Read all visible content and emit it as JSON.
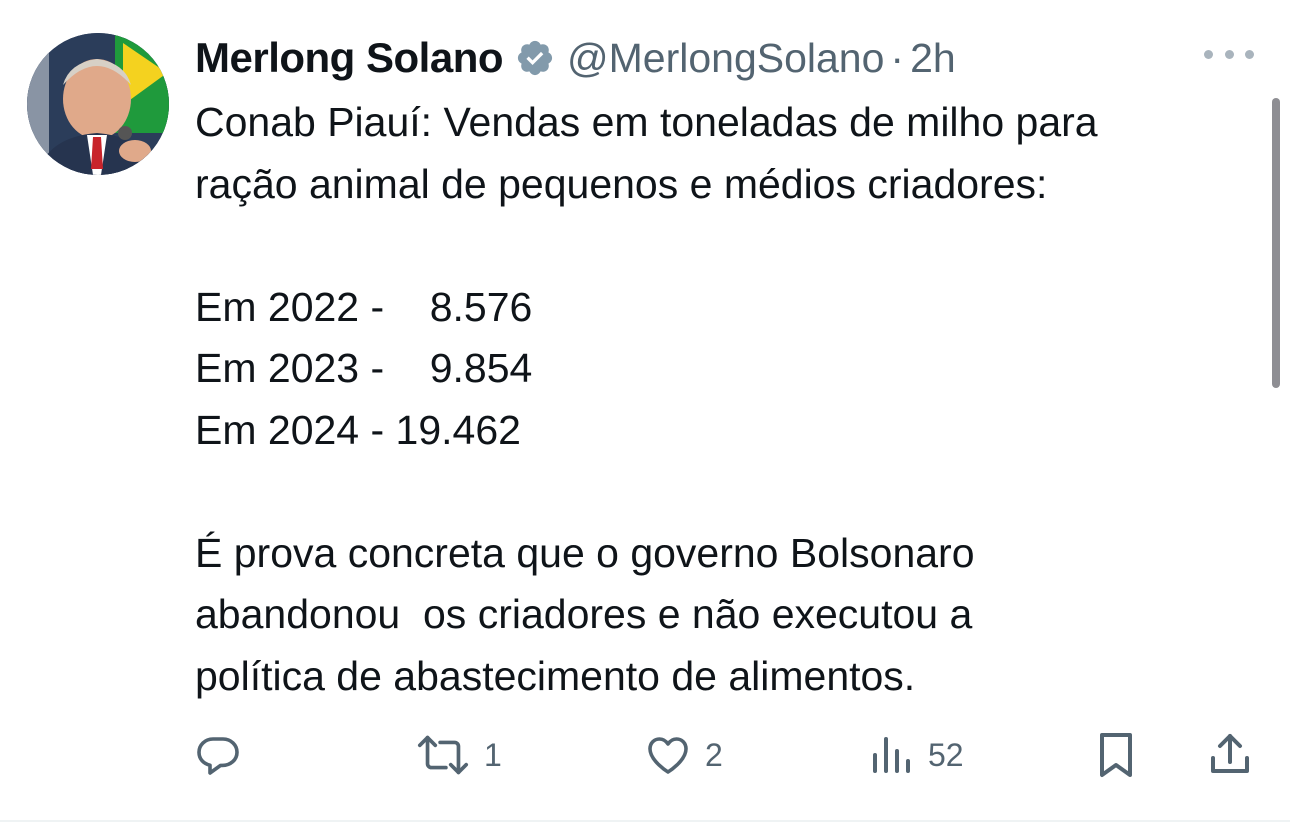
{
  "tweet": {
    "author_name": "Merlong Solano",
    "handle": "@MerlongSolano",
    "separator": "·",
    "time": "2h",
    "verified": true,
    "avatar_colors": {
      "bg": "#2b3d5a",
      "flag_green": "#1f9a3c",
      "flag_yellow": "#f4d21f"
    },
    "lines": [
      "Conab Piauí: Vendas em toneladas de milho para",
      "ração animal de pequenos e médios criadores:",
      "",
      "Em 2022 -    8.576",
      "Em 2023 -    9.854",
      "Em 2024 - 19.462",
      "",
      "É prova concreta que o governo Bolsonaro",
      "abandonou  os criadores e não executou a",
      "política de abastecimento de alimentos."
    ]
  },
  "actions": {
    "reply": {
      "icon": "reply-icon"
    },
    "retweet": {
      "icon": "retweet-icon",
      "count": "1"
    },
    "like": {
      "icon": "heart-icon",
      "count": "2"
    },
    "views": {
      "icon": "views-icon",
      "count": "52"
    },
    "bookmark": {
      "icon": "bookmark-icon"
    },
    "share": {
      "icon": "share-icon"
    }
  },
  "colors": {
    "text": "#0f1419",
    "secondary": "#536471",
    "verified_badge": "#829aab",
    "icon": "#536471"
  }
}
